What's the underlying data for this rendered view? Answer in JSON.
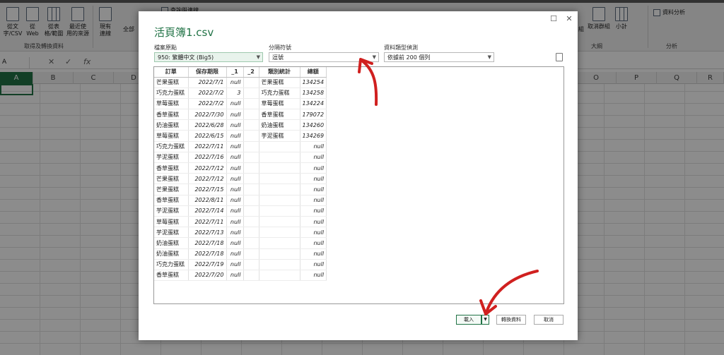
{
  "ribbon": {
    "buttons": [
      {
        "label1": "從文",
        "label2": "字/CSV",
        "icon": "text-csv-icon"
      },
      {
        "label1": "從",
        "label2": "Web",
        "icon": "web-icon"
      },
      {
        "label1": "從表",
        "label2": "格/範圍",
        "icon": "table-icon"
      },
      {
        "label1": "最近使",
        "label2": "用的來源",
        "icon": "recent-sources-icon"
      },
      {
        "label1": "現有",
        "label2": "連線",
        "icon": "connections-icon"
      }
    ],
    "group_label": "取得及轉換資料",
    "refresh_all": "全部",
    "queries_label": "查詢與連線",
    "ungroup": "取消群組",
    "group_suffix": "組",
    "subtotal": "小計",
    "outline_label": "大綱",
    "data_analysis": "資料分析",
    "analysis_label": "分析"
  },
  "formula_bar": {
    "name_box": "A",
    "fx": "fx"
  },
  "columns": [
    "A",
    "B",
    "C",
    "D",
    "O",
    "P",
    "Q",
    "R"
  ],
  "dialog": {
    "title": "活頁簿1.csv",
    "file_origin_label": "檔案原點",
    "file_origin_value": "950: 繁體中文 (Big5)",
    "delimiter_label": "分隔符號",
    "delimiter_value": "逗號",
    "detect_label": "資料類型偵測",
    "detect_value": "依據前 200 個列",
    "table": {
      "headers": [
        "訂單",
        "保存期限",
        "_1",
        "_2",
        "類別統計",
        "總額"
      ],
      "rows": [
        [
          "芒果蛋糕",
          "2022/7/1",
          "null",
          "",
          "芒果蛋糕",
          "134254"
        ],
        [
          "巧克力蛋糕",
          "2022/7/2",
          "3",
          "",
          "巧克力蛋糕",
          "134258"
        ],
        [
          "草莓蛋糕",
          "2022/7/2",
          "null",
          "",
          "草莓蛋糕",
          "134224"
        ],
        [
          "香草蛋糕",
          "2022/7/30",
          "null",
          "",
          "香草蛋糕",
          "179072"
        ],
        [
          "奶油蛋糕",
          "2022/6/28",
          "null",
          "",
          "奶油蛋糕",
          "134260"
        ],
        [
          "草莓蛋糕",
          "2022/6/15",
          "null",
          "",
          "芋泥蛋糕",
          "134269"
        ],
        [
          "巧克力蛋糕",
          "2022/7/11",
          "null",
          "",
          "",
          "null"
        ],
        [
          "芋泥蛋糕",
          "2022/7/16",
          "null",
          "",
          "",
          "null"
        ],
        [
          "香草蛋糕",
          "2022/7/12",
          "null",
          "",
          "",
          "null"
        ],
        [
          "芒果蛋糕",
          "2022/7/12",
          "null",
          "",
          "",
          "null"
        ],
        [
          "芒果蛋糕",
          "2022/7/15",
          "null",
          "",
          "",
          "null"
        ],
        [
          "香草蛋糕",
          "2022/8/11",
          "null",
          "",
          "",
          "null"
        ],
        [
          "芋泥蛋糕",
          "2022/7/14",
          "null",
          "",
          "",
          "null"
        ],
        [
          "草莓蛋糕",
          "2022/7/11",
          "null",
          "",
          "",
          "null"
        ],
        [
          "芋泥蛋糕",
          "2022/7/13",
          "null",
          "",
          "",
          "null"
        ],
        [
          "奶油蛋糕",
          "2022/7/18",
          "null",
          "",
          "",
          "null"
        ],
        [
          "奶油蛋糕",
          "2022/7/18",
          "null",
          "",
          "",
          "null"
        ],
        [
          "巧克力蛋糕",
          "2022/7/19",
          "null",
          "",
          "",
          "null"
        ],
        [
          "香草蛋糕",
          "2022/7/20",
          "null",
          "",
          "",
          "null"
        ]
      ]
    },
    "load_button": "載入",
    "transform_button": "轉換資料",
    "cancel_button": "取消"
  },
  "annotation_color": "#d0201f"
}
